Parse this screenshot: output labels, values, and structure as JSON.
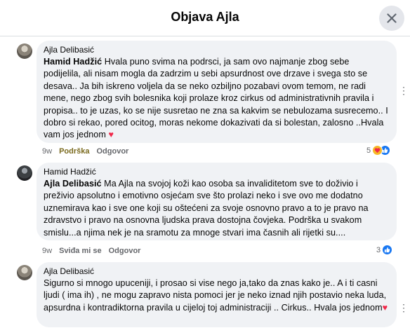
{
  "header": {
    "title": "Objava Ajla"
  },
  "comments": [
    {
      "author": "Ajla Delibasić",
      "mention": "Hamid Hadžić",
      "text": " Hvala puno svima na podrsci, ja sam ovo najmanje zbog sebe podijelila, ali nisam mogla da zadrzim u sebi apsurdnost ove drzave i svega sto se desava.. Ja bih iskreno voljela da se neko ozbiljno pozabavi ovom temom, ne radi mene, nego zbog svih bolesnika koji prolaze kroz cirkus od administrativnih pravila i propisa.. to je uzas, ko se nije susretao ne zna sa kakvim se nebulozama susrecemo.. I dobro si rekao, pored ocitog, moras nekome dokazivati da si bolestan, zalosno ..Hvala vam jos jednom",
      "time": "9w",
      "like_label": "Podrška",
      "reply_label": "Odgovor",
      "reaction_count": "5"
    },
    {
      "author": "Hamid Hadžić",
      "mention": "Ajla Delibasić",
      "text": " Ma Ajla na svojoj koži kao osoba sa invaliditetom sve to doživio i preživio apsolutno i emotivno osjećam sve što prolazi neko i sve ovo me dodatno uznemirava kao i sve one koji su oštećeni za svoje osnovno pravo a to je pravo na zdravstvo i pravo na osnovna ljudska prava dostojna čovjeka. Podrška u svakom smislu...a njima nek je na sramotu za mnoge stvari ima časnih ali rijetki su....",
      "time": "9w",
      "like_label": "Sviđa mi se",
      "reply_label": "Odgovor",
      "reaction_count": "3"
    },
    {
      "author": "Ajla Delibasić",
      "text": "Sigurno si mnogo upuceniji, i prosao si vise nego ja,tako da znas kako je.. A i ti casni ljudi ( ima ih) , ne mogu zapravo nista pomoci jer je neko iznad njih postavio neka luda, apsurdna i kontradiktorna pravila u cijeloj toj administraciji .. Cirkus.. Hvala jos jednom"
    }
  ],
  "icons": {
    "close": "close-icon",
    "more": "more-dots-icon",
    "heart": "heart-emoji",
    "like": "like-reaction-icon",
    "care": "care-reaction-icon"
  },
  "colors": {
    "like_blue": "#1877f2",
    "heart_red": "#f02849",
    "bubble": "#f0f2f5"
  }
}
